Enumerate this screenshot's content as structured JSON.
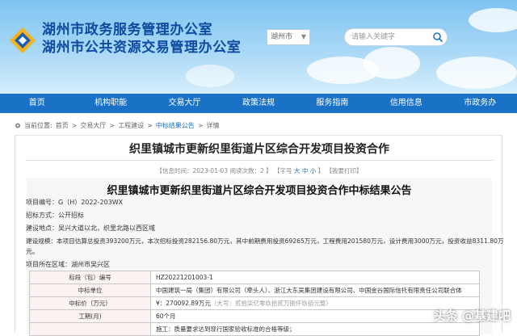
{
  "header": {
    "title_line1": "湖州市政务服务管理办公室",
    "title_line2": "湖州市公共资源交易管理办公室",
    "city_select": "湖州市",
    "search_placeholder": "请输入关键字"
  },
  "nav": {
    "items": [
      "首页",
      "机构职能",
      "交易大厅",
      "政策法规",
      "服务指南",
      "信用信息",
      "市政务办"
    ]
  },
  "breadcrumb": {
    "prefix": "当前位置:",
    "items": [
      "首页",
      "交易大厅",
      "工程建设",
      "中标结果公告",
      "详情"
    ]
  },
  "article": {
    "title": "织里镇城市更新织里街道片区综合开发项目投资合作",
    "meta": {
      "date": "【信息时间：2023-01-03",
      "views": "阅读次数：2 】",
      "font_size": "【字号",
      "font_large": "大",
      "font_mid": "中",
      "font_small": "小",
      "font_end": "】",
      "print": "【我要打印】"
    },
    "announcement_title": "织里镇城市更新织里街道片区综合开发项目投资合作中标结果公告",
    "info": {
      "project_no": "项目编号：G（H）2022-203WX",
      "method": "招标方式：公开招标",
      "location": "建设地点：吴兴大道以北，织里北路以西区域",
      "scale": "建设规模：本项目估算总投资393200万元，本次招标投资282156.80万元，其中前期费用投资69265万元，工程费用201580万元，设计费用3000万元，投资收益8311.80万",
      "scale_cont": "元。",
      "region": "项目所在区域：湖州市吴兴区"
    },
    "table": [
      {
        "label": "标段（包）编号",
        "value": "HZ20221201003-1"
      },
      {
        "label": "中标单位",
        "value": "中国建筑一局（集团）有限公司（牵头人）、浙江大东吴集团建设有限公司、中国金谷国际信托有限责任公司联合体"
      },
      {
        "label": "中标价（万元）",
        "value": "¥：270092.89万元",
        "value_note": "（大写：贰拾柒亿零玖拾贰万捌仟玖佰元整）"
      },
      {
        "label": "工期(月)",
        "value": "60个月"
      },
      {
        "label": "",
        "value": "施工：质量要求达到现行国家验收标准的合格等级；"
      }
    ]
  },
  "watermark": {
    "text": "头条 @基建吧"
  }
}
